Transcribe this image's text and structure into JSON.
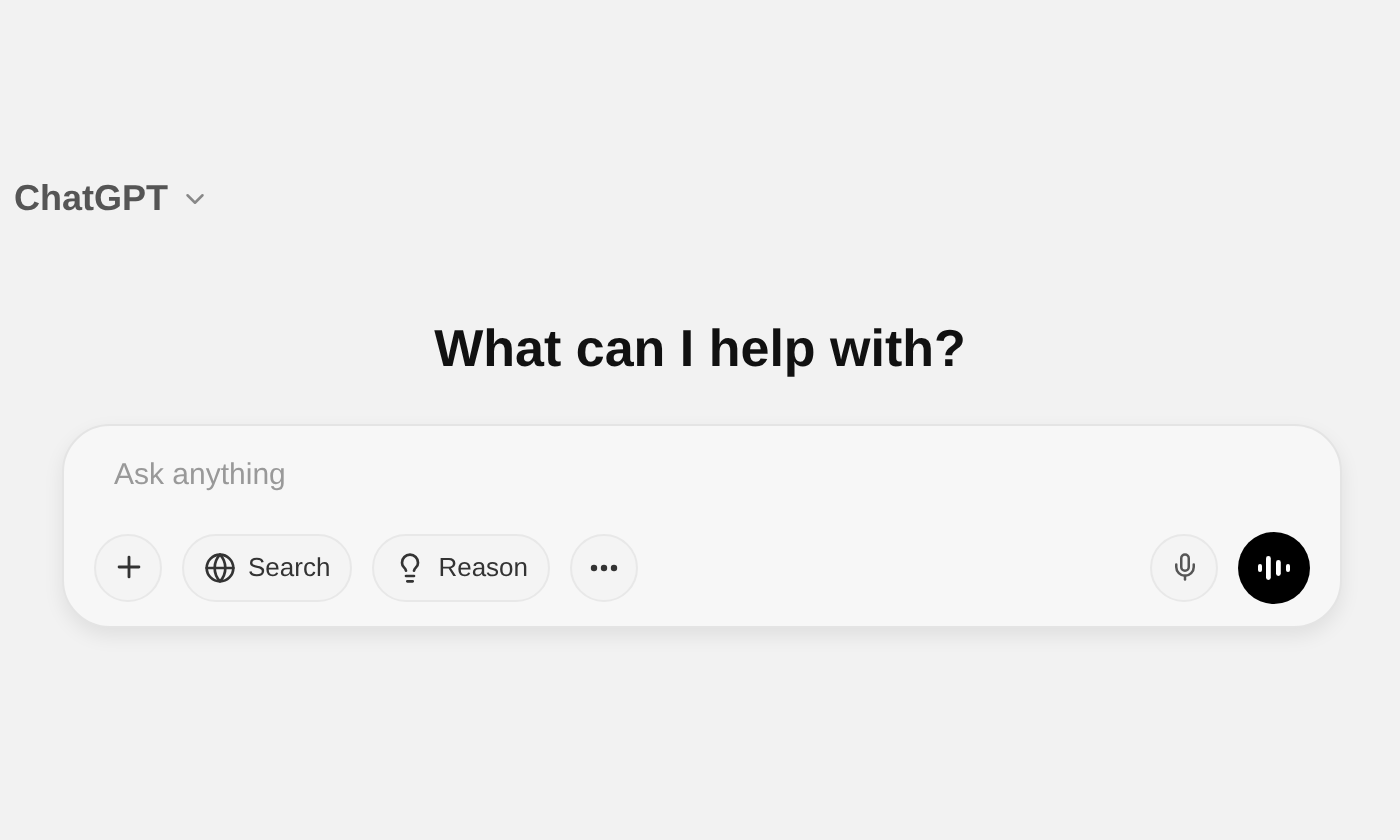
{
  "model_menu": {
    "label": "ChatGPT"
  },
  "heading": "What can I help with?",
  "composer": {
    "placeholder": "Ask anything",
    "tools": [
      {
        "kind": "plus"
      },
      {
        "kind": "search",
        "label": "Search"
      },
      {
        "kind": "reason",
        "label": "Reason"
      },
      {
        "kind": "more"
      }
    ]
  }
}
